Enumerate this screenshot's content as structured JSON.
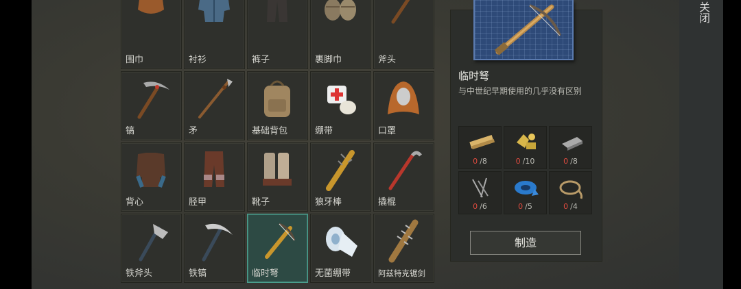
{
  "close_button": {
    "label": "关闭"
  },
  "recipes": [
    {
      "label": "围巾",
      "icon": "scarf-icon",
      "selected": false
    },
    {
      "label": "衬衫",
      "icon": "shirt-icon",
      "selected": false
    },
    {
      "label": "裤子",
      "icon": "pants-icon",
      "selected": false
    },
    {
      "label": "裹脚巾",
      "icon": "foot-wraps-icon",
      "selected": false
    },
    {
      "label": "斧头",
      "icon": "axe-icon",
      "selected": false
    },
    {
      "label": "镐",
      "icon": "pickaxe-icon",
      "selected": false
    },
    {
      "label": "矛",
      "icon": "spear-icon",
      "selected": false
    },
    {
      "label": "基础背包",
      "icon": "backpack-icon",
      "selected": false
    },
    {
      "label": "绷带",
      "icon": "bandage-icon",
      "selected": false
    },
    {
      "label": "口罩",
      "icon": "hood-mask-icon",
      "selected": false
    },
    {
      "label": "背心",
      "icon": "vest-icon",
      "selected": false
    },
    {
      "label": "胫甲",
      "icon": "greaves-icon",
      "selected": false
    },
    {
      "label": "靴子",
      "icon": "boots-icon",
      "selected": false
    },
    {
      "label": "狼牙棒",
      "icon": "spiked-club-icon",
      "selected": false
    },
    {
      "label": "撬棍",
      "icon": "crowbar-icon",
      "selected": false
    },
    {
      "label": "铁斧头",
      "icon": "iron-axe-icon",
      "selected": false
    },
    {
      "label": "铁镐",
      "icon": "iron-pickaxe-icon",
      "selected": false
    },
    {
      "label": "临时弩",
      "icon": "crossbow-icon",
      "selected": true
    },
    {
      "label": "无菌绷带",
      "icon": "sterile-bandage-icon",
      "selected": false
    },
    {
      "label": "阿兹特克锯剑",
      "icon": "aztec-sword-icon",
      "selected": false
    }
  ],
  "detail": {
    "blueprint_icon": "crossbow-blueprint-icon",
    "name": "临时弩",
    "description": "与中世纪早期使用的几乎没有区别",
    "materials": [
      {
        "icon": "wood-plank-icon",
        "have": "0",
        "need": "/8"
      },
      {
        "icon": "scrap-metal-icon",
        "have": "0",
        "need": "/10"
      },
      {
        "icon": "iron-bar-icon",
        "have": "0",
        "need": "/8"
      },
      {
        "icon": "nails-icon",
        "have": "0",
        "need": "/6"
      },
      {
        "icon": "duct-tape-icon",
        "have": "0",
        "need": "/5"
      },
      {
        "icon": "rope-icon",
        "have": "0",
        "need": "/4"
      }
    ],
    "craft_label": "制造"
  },
  "colors": {
    "selected_border": "#4a9e8d",
    "missing_count": "#e04b3f",
    "blueprint": "#2e4a78"
  }
}
